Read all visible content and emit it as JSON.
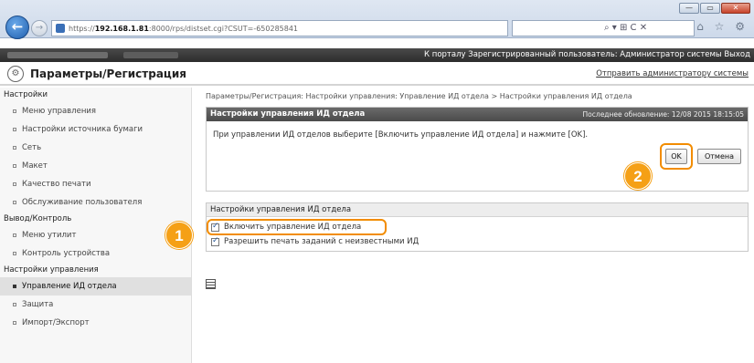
{
  "browser": {
    "url_prefix": "https://",
    "url_host": "192.168.1.81",
    "url_path": ":8000/rps/distset.cgi?CSUT=-650285841",
    "url_tools": "⌕ ▾ ⊞ C ✕",
    "icons": "⌂ ☆ ⚙",
    "window_buttons": [
      "—",
      "▭",
      "✕"
    ]
  },
  "topbar": {
    "right_text": "К порталу   Зарегистрированный пользователь: Администратор системы  Выход"
  },
  "title": {
    "text": "Параметры/Регистрация",
    "send_link": "Отправить администратору системы"
  },
  "sidebar": {
    "groups": [
      {
        "label": "Настройки",
        "items": [
          "Меню управления",
          "Настройки источника бумаги",
          "Сеть",
          "Макет",
          "Качество печати",
          "Обслуживание пользователя"
        ]
      },
      {
        "label": "Вывод/Контроль",
        "items": [
          "Меню утилит",
          "Контроль устройства"
        ]
      },
      {
        "label": "Настройки управления",
        "items": [
          "Управление ИД отдела",
          "Защита",
          "Импорт/Экспорт"
        ]
      }
    ]
  },
  "breadcrumb": "Параметры/Регистрация: Настройки управления: Управление ИД отдела > Настройки управления ИД отдела",
  "panel1": {
    "title": "Настройки управления ИД отдела",
    "updated": "Последнее обновление: 12/08 2015 18:15:05",
    "instruction": "При управлении ИД отделов выберите [Включить управление ИД отдела] и нажмите [OK].",
    "ok_label": "OK",
    "cancel_label": "Отмена"
  },
  "panel2": {
    "title": "Настройки управления ИД отдела",
    "options": [
      {
        "label": "Включить управление ИД отдела",
        "checked": true
      },
      {
        "label": "Разрешить печать заданий с неизвестными ИД",
        "checked": true
      }
    ]
  },
  "callouts": [
    "1",
    "2"
  ],
  "colors": {
    "accent": "#f5a016",
    "header_dark": "#4b4b4b"
  }
}
